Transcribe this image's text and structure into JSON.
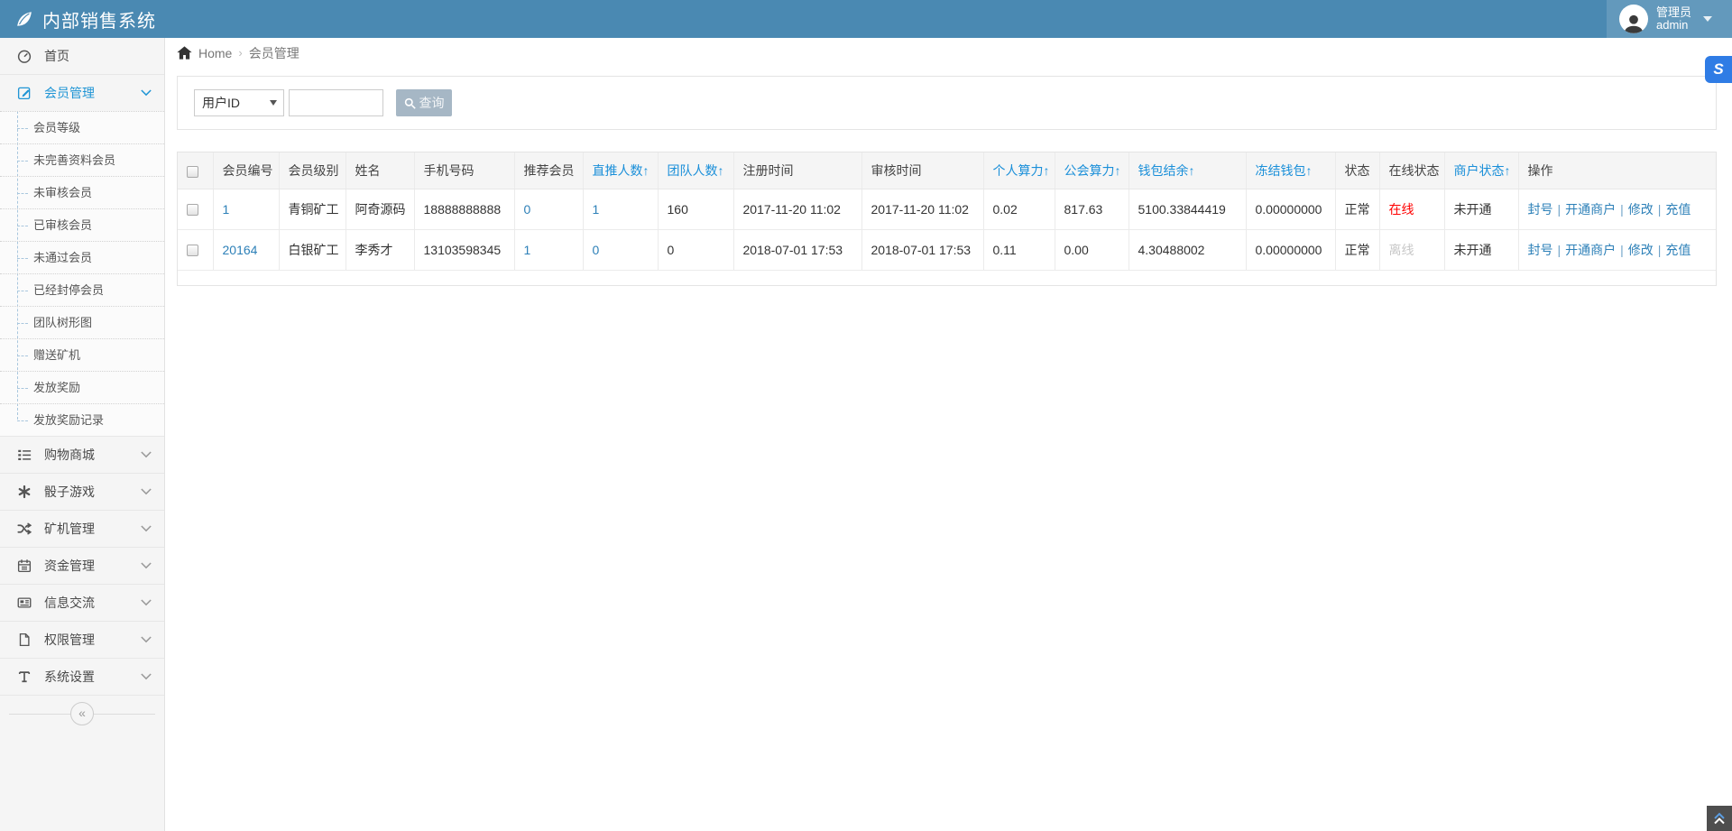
{
  "app": {
    "title": "内部销售系统"
  },
  "user": {
    "role": "管理员",
    "name": "admin"
  },
  "breadcrumb": {
    "home": "Home",
    "separator": "›",
    "current": "会员管理"
  },
  "sidebar": {
    "items": [
      {
        "label": "首页",
        "icon": "dashboard-icon"
      },
      {
        "label": "会员管理",
        "icon": "edit-icon",
        "active": true,
        "expanded": true,
        "children": [
          "会员等级",
          "未完善资料会员",
          "未审核会员",
          "已审核会员",
          "未通过会员",
          "已经封停会员",
          "团队树形图",
          "赠送矿机",
          "发放奖励",
          "发放奖励记录"
        ]
      },
      {
        "label": "购物商城",
        "icon": "list-icon"
      },
      {
        "label": "骰子游戏",
        "icon": "asterisk-icon"
      },
      {
        "label": "矿机管理",
        "icon": "shuffle-icon"
      },
      {
        "label": "资金管理",
        "icon": "calendar-icon"
      },
      {
        "label": "信息交流",
        "icon": "newspaper-icon"
      },
      {
        "label": "权限管理",
        "icon": "file-icon"
      },
      {
        "label": "系统设置",
        "icon": "text-height-icon"
      }
    ],
    "collapse_glyph": "«"
  },
  "search": {
    "field_selected": "用户ID",
    "input_value": "",
    "button_label": "查询"
  },
  "table": {
    "sort_arrow": "↑",
    "action_separator": "|",
    "columns": [
      {
        "label": "会员编号",
        "sortable": false
      },
      {
        "label": "会员级别",
        "sortable": false
      },
      {
        "label": "姓名",
        "sortable": false
      },
      {
        "label": "手机号码",
        "sortable": false
      },
      {
        "label": "推荐会员",
        "sortable": false
      },
      {
        "label": "直推人数",
        "sortable": true
      },
      {
        "label": "团队人数",
        "sortable": true
      },
      {
        "label": "注册时间",
        "sortable": false
      },
      {
        "label": "审核时间",
        "sortable": false
      },
      {
        "label": "个人算力",
        "sortable": true
      },
      {
        "label": "公会算力",
        "sortable": true
      },
      {
        "label": "钱包结余",
        "sortable": true
      },
      {
        "label": "冻结钱包",
        "sortable": true
      },
      {
        "label": "状态",
        "sortable": false
      },
      {
        "label": "在线状态",
        "sortable": false
      },
      {
        "label": "商户状态",
        "sortable": true
      },
      {
        "label": "操作",
        "sortable": false
      }
    ],
    "rows": [
      {
        "id": "1",
        "level": "青铜矿工",
        "name": "阿奇源码",
        "phone": "18888888888",
        "referrer": "0",
        "direct_count": "1",
        "team_count": "160",
        "register_time": "2017-11-20 11:02",
        "audit_time": "2017-11-20 11:02",
        "personal_power": "0.02",
        "guild_power": "817.63",
        "wallet_balance": "5100.33844419",
        "frozen_wallet": "0.00000000",
        "status": "正常",
        "online_status": "在线",
        "merchant_status": "未开通",
        "actions": [
          "封号",
          "开通商户",
          "修改",
          "充值"
        ]
      },
      {
        "id": "20164",
        "level": "白银矿工",
        "name": "李秀才",
        "phone": "13103598345",
        "referrer": "1",
        "direct_count": "0",
        "team_count": "0",
        "register_time": "2018-07-01 17:53",
        "audit_time": "2018-07-01 17:53",
        "personal_power": "0.11",
        "guild_power": "0.00",
        "wallet_balance": "4.30488002",
        "frozen_wallet": "0.00000000",
        "status": "正常",
        "online_status": "离线",
        "merchant_status": "未开通",
        "actions": [
          "封号",
          "开通商户",
          "修改",
          "充值"
        ]
      }
    ]
  },
  "floating": {
    "side_badge_glyph": "S"
  },
  "colors": {
    "header_bg": "#4a89b2",
    "accent": "#2095d5",
    "link": "#2d80b8",
    "sortable_header": "#1a8fd9",
    "online_red": "#ff0000",
    "offline_gray": "#c8c8c8",
    "search_button_bg": "#a6b7c5",
    "side_badge_bg": "#2f7ce5"
  }
}
